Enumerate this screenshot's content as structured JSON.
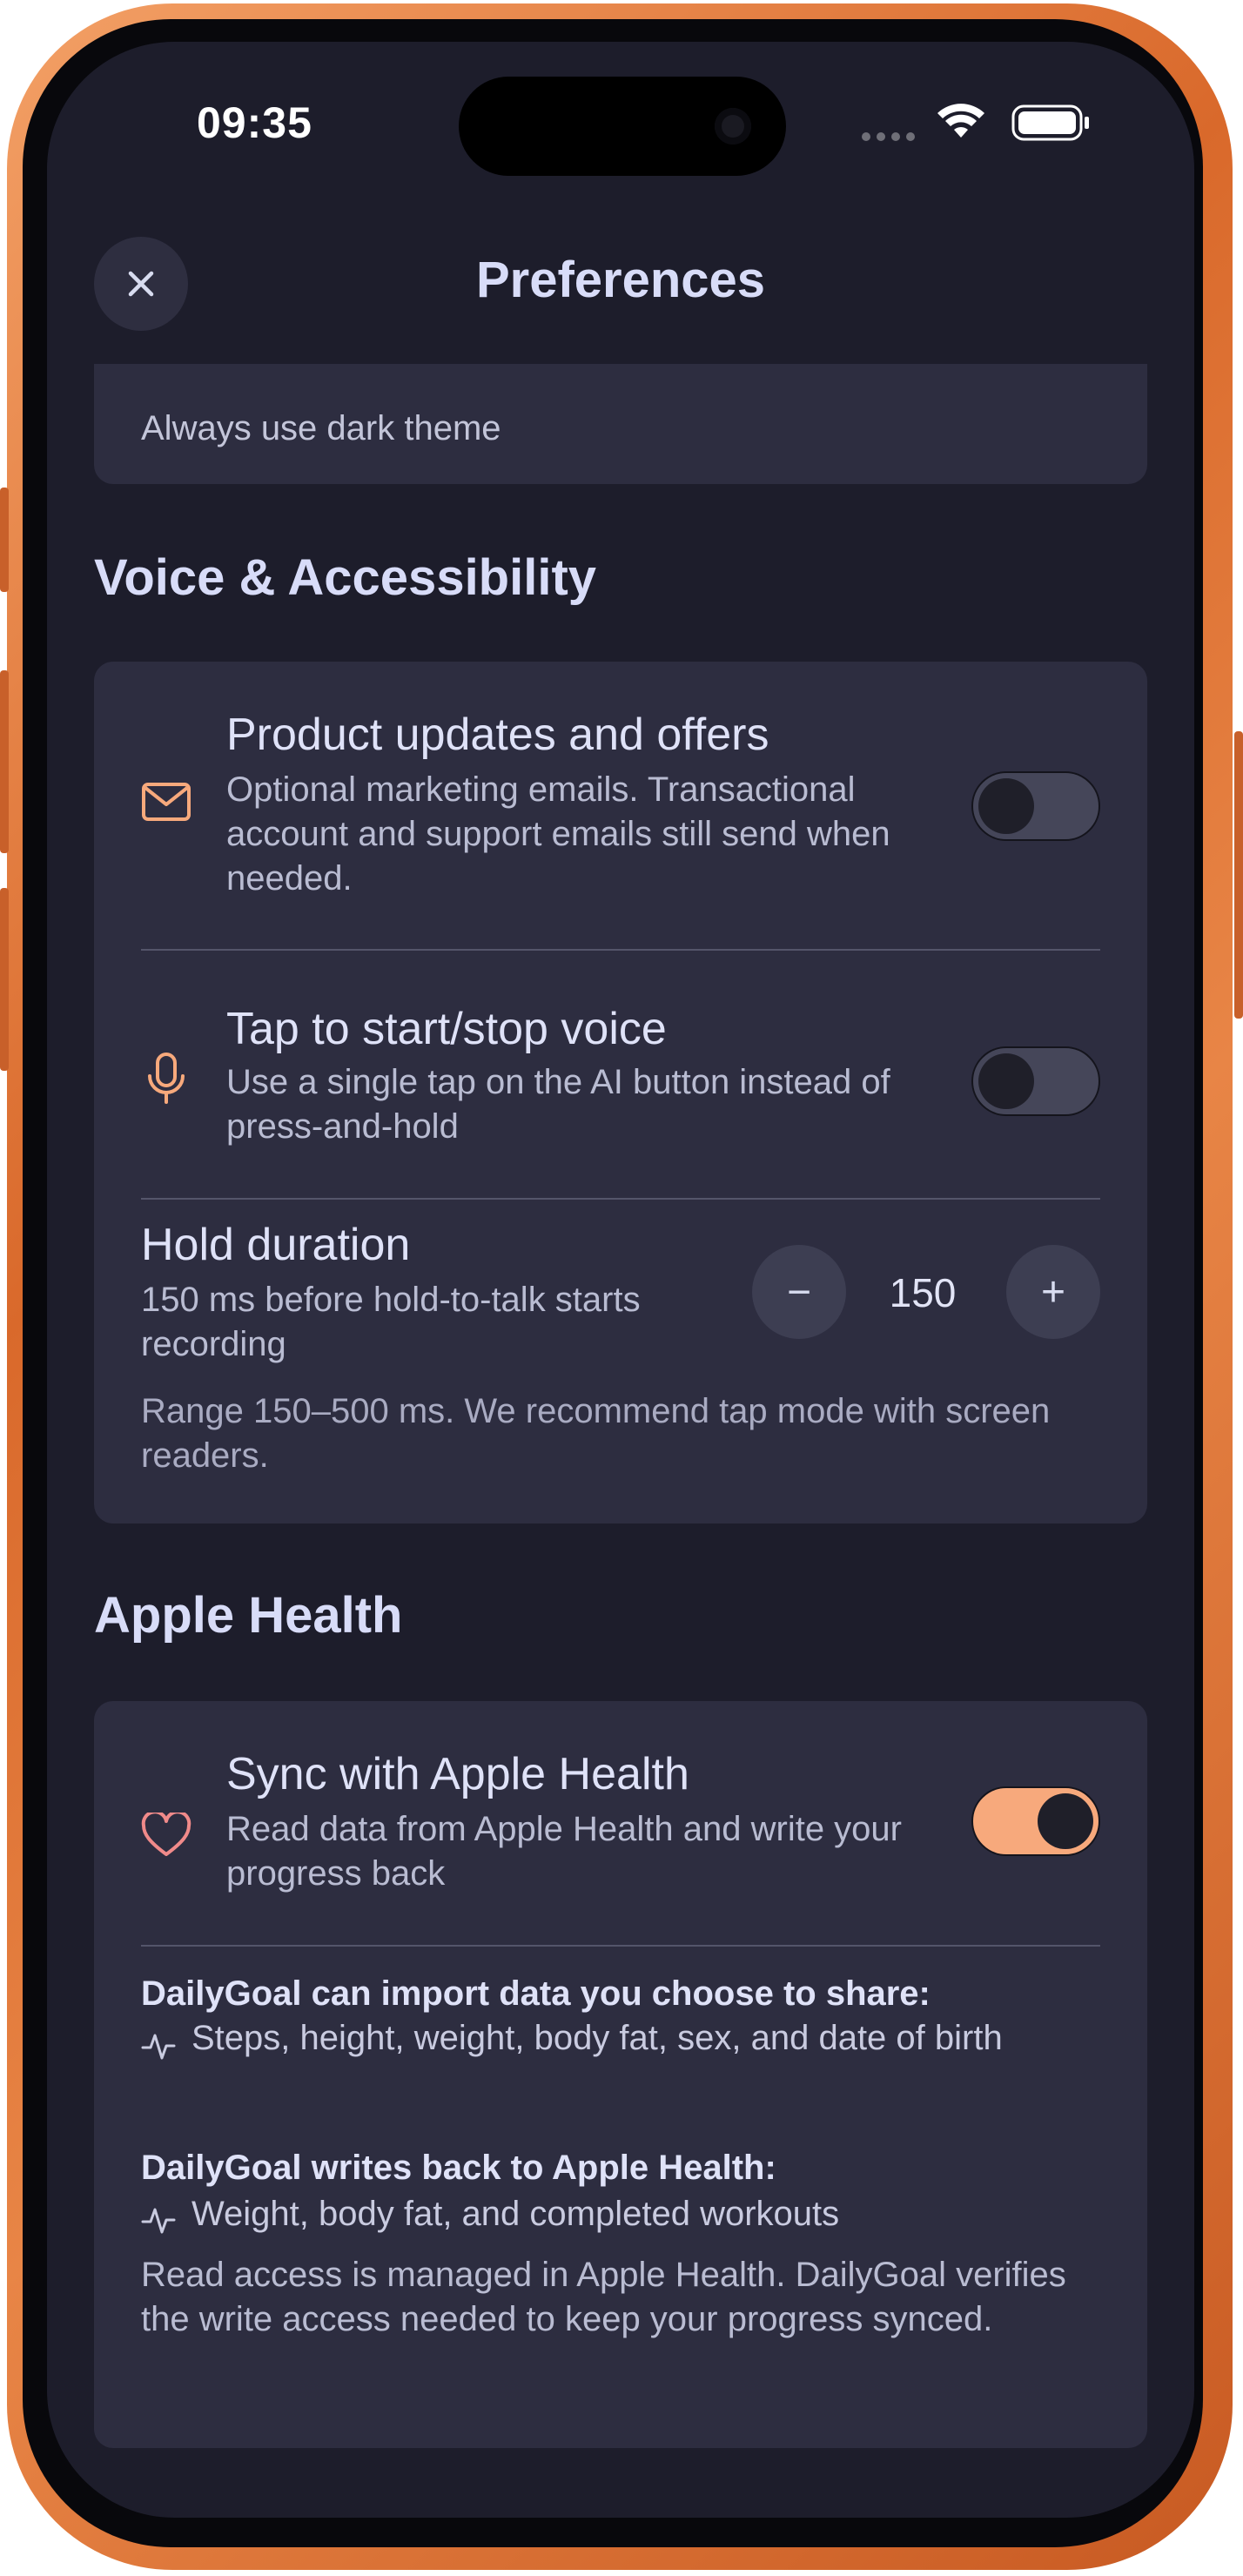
{
  "status_bar": {
    "time": "09:35"
  },
  "header": {
    "title": "Preferences"
  },
  "appearance": {
    "dark_theme_text": "Always use dark theme"
  },
  "voice_section": {
    "title": "Voice & Accessibility",
    "product_updates": {
      "title": "Product updates and offers",
      "description": "Optional marketing emails. Transactional account and support emails still send when needed.",
      "enabled": false,
      "icon": "mail-icon"
    },
    "tap_voice": {
      "title": "Tap to start/stop voice",
      "description": "Use a single tap on the AI button instead of press-and-hold",
      "enabled": false,
      "icon": "microphone-icon"
    },
    "hold_duration": {
      "title": "Hold duration",
      "description": "150 ms before hold-to-talk starts recording",
      "value": "150",
      "decrement_label": "−",
      "increment_label": "+",
      "note": "Range 150–500 ms. We recommend tap mode with screen readers."
    }
  },
  "health_section": {
    "title": "Apple Health",
    "sync": {
      "title": "Sync with Apple Health",
      "description": "Read data from Apple Health and write your progress back",
      "enabled": true,
      "icon": "heart-icon"
    },
    "import_heading": "DailyGoal can import data you choose to share:",
    "import_item": "Steps, height, weight, body fat, sex, and date of birth",
    "write_heading": "DailyGoal writes back to Apple Health:",
    "write_item": "Weight, body fat, and completed workouts",
    "footer": "Read access is managed in Apple Health. DailyGoal verifies the write access needed to keep your progress synced."
  },
  "colors": {
    "background": "#1d1d2b",
    "card": "#2d2d40",
    "accent": "#f7a97c",
    "heart": "#f08a8a",
    "frame": "#e07a3a"
  }
}
